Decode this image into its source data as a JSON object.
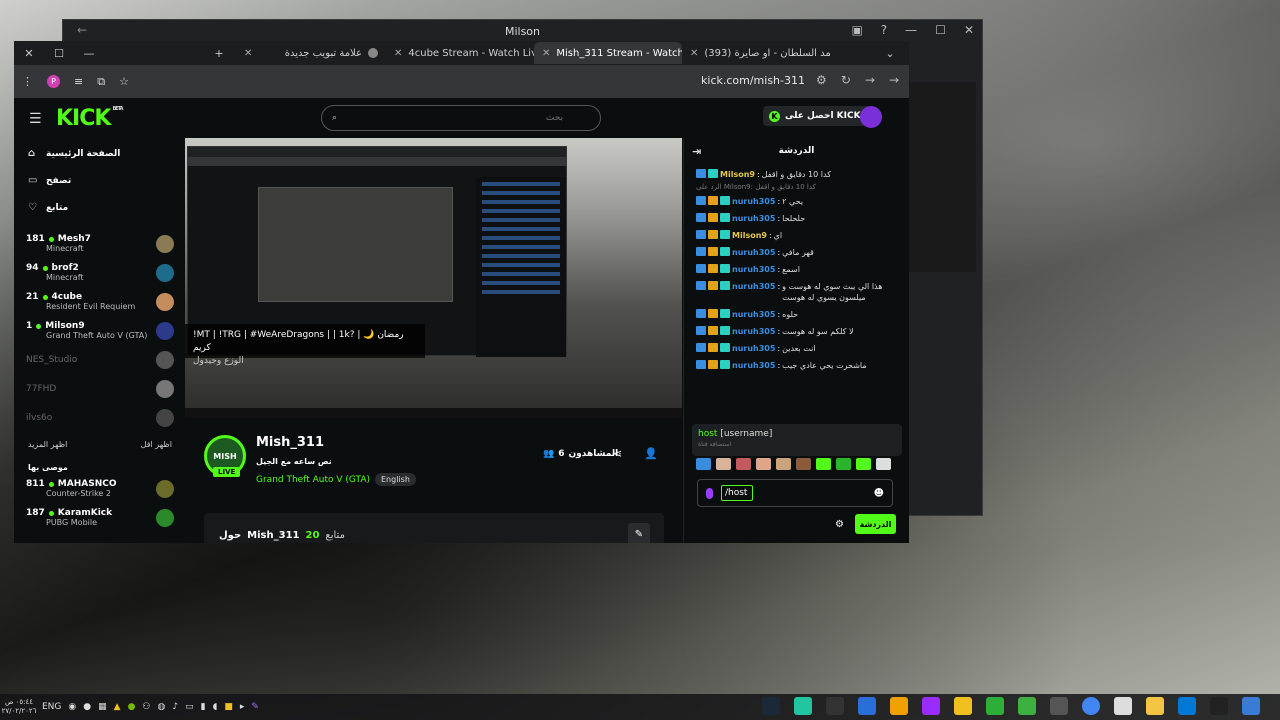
{
  "outer_window": {
    "title": "Milson"
  },
  "tabs": [
    {
      "label": "Mish_311 Stream - Watch Live ...",
      "active": true,
      "color": "#53fc18"
    },
    {
      "label": "4cube Stream - Watch Live on ...",
      "active": false,
      "color": "#53fc18"
    },
    {
      "label": "علامة تبويب جديدة",
      "active": false,
      "color": "#888888"
    },
    {
      "label": "(393) احمد السلطان - او صايرة ...",
      "active": false,
      "color": "#ff0000"
    }
  ],
  "address": {
    "url": "kick.com/mish-311",
    "avatar_letter": "P"
  },
  "kick": {
    "logo": "KICK",
    "beta": "BETA",
    "search_placeholder": "بحث",
    "get_kicks": "احصل على KICKs",
    "accent": "#53fc18"
  },
  "sidebar": {
    "nav": [
      {
        "label": "الصفحة الرئيسية",
        "icon": "home-icon"
      },
      {
        "label": "تصفح",
        "icon": "browse-icon"
      },
      {
        "label": "متابع",
        "icon": "heart-icon"
      }
    ],
    "following": [
      {
        "viewers": "181",
        "name": "Mesh7",
        "game": "Minecraft",
        "online": true,
        "avatar": "#8a7a55"
      },
      {
        "viewers": "94",
        "name": "brof2",
        "game": "Minecraft",
        "online": true,
        "avatar": "#1f6b8c"
      },
      {
        "viewers": "21",
        "name": "4cube",
        "game": "Resident Evil Requiem",
        "online": true,
        "avatar": "#c48d5b"
      },
      {
        "viewers": "1",
        "name": "Milson9",
        "game": "Grand Theft Auto V (GTA)",
        "online": true,
        "avatar": "#2b3a8a"
      },
      {
        "viewers": "",
        "name": "NES_Studio",
        "game": "",
        "online": false,
        "avatar": "#555555"
      },
      {
        "viewers": "",
        "name": "77FHD",
        "game": "",
        "online": false,
        "avatar": "#777777"
      },
      {
        "viewers": "",
        "name": "ilvs6o",
        "game": "",
        "online": false,
        "avatar": "#444444"
      }
    ],
    "show_more": "اظهر المزيد",
    "show_less": "اظهر اقل",
    "recommended_title": "موصى بها",
    "recommended": [
      {
        "viewers": "811",
        "name": "MAHASNCO",
        "game": "Counter-Strike 2",
        "avatar": "#6b6b2a"
      },
      {
        "viewers": "187",
        "name": "KaramKick",
        "game": "PUBG Mobile",
        "avatar": "#2a8a2a"
      }
    ]
  },
  "player": {
    "overlay_line1": "!MT | !TRG | #WeAreDragons | | 1k? | 🌙 رمضان كريم",
    "overlay_line2": "الوزع وجيدول"
  },
  "stream": {
    "streamer": "Mish_311",
    "live": "LIVE",
    "title": "نص ساعه مع الجيل",
    "game": "Grand Theft Auto V (GTA)",
    "language": "English",
    "viewers_label": "المشاهدون",
    "viewers": "6",
    "about_prefix": "حول",
    "about_name": "Mish_311",
    "followers": "20",
    "followers_label": "متابع"
  },
  "chat": {
    "title": "الدردشة",
    "messages": [
      {
        "user": "Milson9",
        "text": "كدا 10 دقايق و اقفل",
        "color": "#e3c84a"
      },
      {
        "user": "",
        "text": "الرد على Milson9: كدا 10 دقايق و اقفل",
        "color": "#777777",
        "reply": true
      },
      {
        "user": "nuruh305",
        "text": "يحي ٢",
        "color": "#3a8ee0"
      },
      {
        "user": "nuruh305",
        "text": "حلحلحا",
        "color": "#3a8ee0"
      },
      {
        "user": "Milson9",
        "text": "اي",
        "color": "#e3c84a"
      },
      {
        "user": "nuruh305",
        "text": "قهر مافي",
        "color": "#3a8ee0"
      },
      {
        "user": "nuruh305",
        "text": "اسمع",
        "color": "#3a8ee0"
      },
      {
        "user": "nuruh305",
        "text": "هذا الي يبث سوي له هوست و ميلسون يسوي له هوست",
        "color": "#3a8ee0"
      },
      {
        "user": "nuruh305",
        "text": "حلوه",
        "color": "#3a8ee0"
      },
      {
        "user": "nuruh305",
        "text": "لا كلكم سو له هوست",
        "color": "#3a8ee0"
      },
      {
        "user": "nuruh305",
        "text": "انت بعدين",
        "color": "#3a8ee0"
      },
      {
        "user": "nuruh305",
        "text": "ماشحرت يحي عادي جيب",
        "color": "#3a8ee0"
      }
    ],
    "command": "host",
    "command_arg": "[username]",
    "command_hint": "استضافة قناة",
    "input_value": "/host",
    "send": "الدردشة"
  },
  "taskbar": {
    "time": "٠٥:٤٤ ص",
    "date": "٢٧/٠٢/٢٠٢٦",
    "lang": "ENG"
  }
}
